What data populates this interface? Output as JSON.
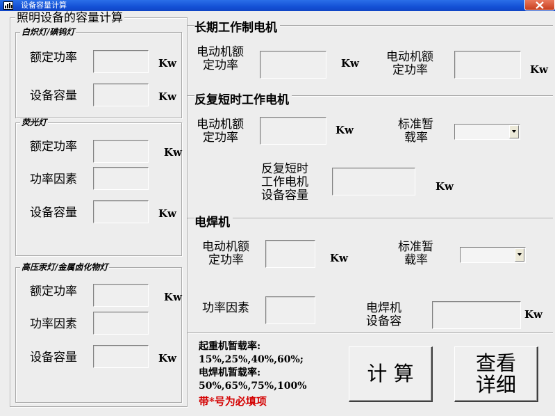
{
  "window": {
    "title": "设备容量计算"
  },
  "lighting": {
    "title": "照明设备的容量计算",
    "incandescent": {
      "title": "白炽灯/碘钨灯",
      "rated_power": {
        "label": "额定功率",
        "value": "",
        "unit": "Kw"
      },
      "capacity": {
        "label": "设备容量",
        "value": "",
        "unit": "Kw"
      }
    },
    "fluorescent": {
      "title": "荧光灯",
      "rated_power": {
        "label": "额定功率",
        "value": "",
        "unit": "Kw"
      },
      "power_factor": {
        "label": "功率因素",
        "value": ""
      },
      "capacity": {
        "label": "设备容量",
        "value": "",
        "unit": "Kw"
      }
    },
    "hid": {
      "title": "高压汞灯/金属卤化物灯",
      "rated_power": {
        "label": "额定功率",
        "value": "",
        "unit": "Kw"
      },
      "power_factor": {
        "label": "功率因素",
        "value": ""
      },
      "capacity": {
        "label": "设备容量",
        "value": "",
        "unit": "Kw"
      }
    }
  },
  "long_term": {
    "title": "长期工作制电机",
    "rated_power": {
      "label_1": "电动机额",
      "label_2": "定功率",
      "value": "",
      "unit": "Kw"
    },
    "rated_power_2": {
      "label_1": "电动机额",
      "label_2": "定功率",
      "value": "",
      "unit": "Kw"
    }
  },
  "repeated": {
    "title": "反复短时工作电机",
    "rated_power": {
      "label_1": "电动机额",
      "label_2": "定功率",
      "value": "",
      "unit": "Kw"
    },
    "duty": {
      "label_1": "标准暂",
      "label_2": "载率",
      "selected": ""
    },
    "capacity": {
      "label_1": "反复短时",
      "label_2": "工作电机",
      "label_3": "设备容量",
      "value": "",
      "unit": "Kw"
    }
  },
  "welder": {
    "title": "电焊机",
    "rated_power": {
      "label_1": "电动机额",
      "label_2": "定功率",
      "value": "",
      "unit": "Kw"
    },
    "duty": {
      "label_1": "标准暂",
      "label_2": "载率",
      "selected": ""
    },
    "power_factor": {
      "label": "功率因素",
      "value": ""
    },
    "capacity": {
      "label_1": "电焊机",
      "label_2": "设备容",
      "value": "",
      "unit": "Kw"
    }
  },
  "notes": {
    "line1": "起重机暂载率:",
    "line2": "15%,25%,40%,60%;",
    "line3": "电焊机暂载率:",
    "line4": "50%,65%,75%,100%",
    "required": "带*号为必填项"
  },
  "buttons": {
    "calculate": "计 算",
    "details": "查看\n详细"
  },
  "colors": {
    "required_text": "#d40000",
    "titlebar": "#1451d6"
  }
}
